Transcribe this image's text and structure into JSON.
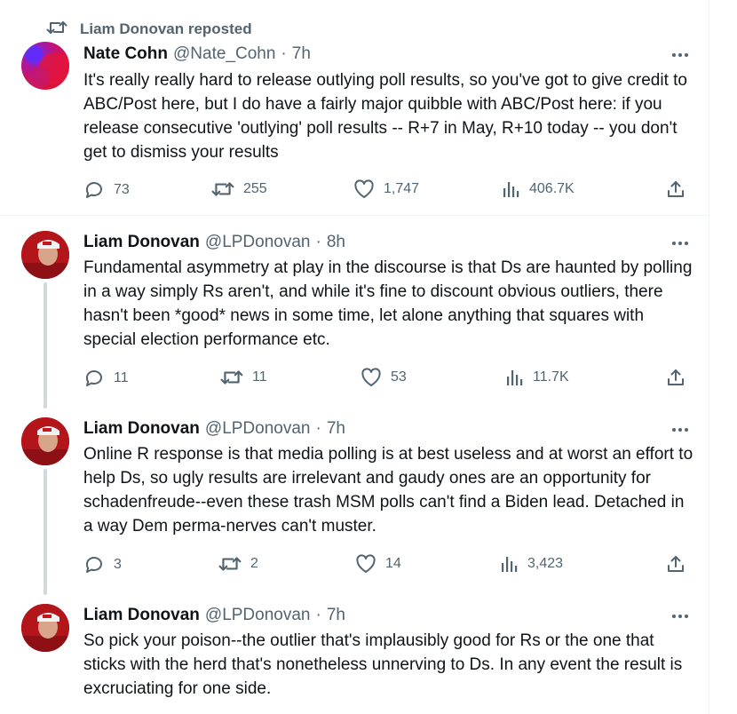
{
  "repost_header": {
    "label": "Liam Donovan reposted",
    "icon": "repost-icon"
  },
  "tweets": [
    {
      "name": "Nate Cohn",
      "handle": "@Nate_Cohn",
      "time": "7h",
      "text": "It's really really hard to release outlying poll results, so you've got to give credit to ABC/Post here, but I do have a fairly major quibble with ABC/Post here: if you release consecutive 'outlying' poll results -- R+7 in May, R+10 today -- you don't get to dismiss your results",
      "replies": "73",
      "reposts": "255",
      "likes": "1,747",
      "views": "406.7K"
    },
    {
      "name": "Liam Donovan",
      "handle": "@LPDonovan",
      "time": "8h",
      "text": "Fundamental asymmetry at play in the discourse is that Ds are haunted by polling in a way simply Rs aren't, and while it's fine to discount obvious outliers, there hasn't been *good* news in some time, let alone anything that squares with special election performance etc.",
      "replies": "11",
      "reposts": "11",
      "likes": "53",
      "views": "11.7K"
    },
    {
      "name": "Liam Donovan",
      "handle": "@LPDonovan",
      "time": "7h",
      "text": "Online R response is that media polling is at best useless and at worst an effort to help Ds, so ugly results are irrelevant and gaudy ones are an opportunity for schadenfreude--even these trash MSM polls can't find a Biden lead. Detached in a way Dem perma-nerves can't muster.",
      "replies": "3",
      "reposts": "2",
      "likes": "14",
      "views": "3,423"
    },
    {
      "name": "Liam Donovan",
      "handle": "@LPDonovan",
      "time": "7h",
      "text": "So pick your poison--the outlier that's implausibly good for Rs or the one that sticks with the herd that's nonetheless unnerving to Ds. In any event the result is excruciating for one side."
    }
  ],
  "separator": "·",
  "colors": {
    "text": "#0f1419",
    "secondary": "#536471",
    "border": "#eff3f4",
    "thread": "#cfd9de"
  }
}
